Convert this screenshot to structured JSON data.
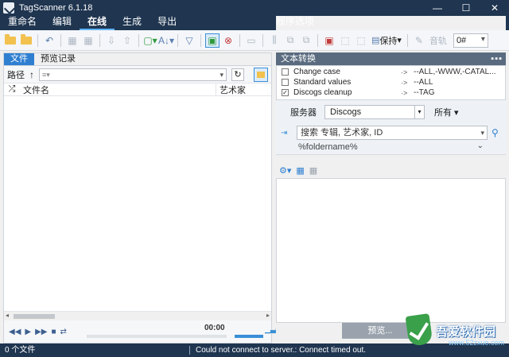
{
  "window": {
    "title": "TagScanner 6.1.18",
    "min": "—",
    "max": "☐",
    "close": "✕"
  },
  "menu": {
    "items": [
      {
        "label": "重命名",
        "active": false
      },
      {
        "label": "编辑",
        "active": false
      },
      {
        "label": "在线",
        "active": true
      },
      {
        "label": "生成",
        "active": false
      },
      {
        "label": "导出",
        "active": false
      }
    ],
    "options": "程序选项"
  },
  "toolbar": {
    "keep_label": "保持",
    "track_label": "音轨",
    "track_value": "0#"
  },
  "left": {
    "tabs": [
      "文件",
      "预览记录"
    ],
    "path_label": "路径",
    "path_value": "≡▾",
    "columns": [
      "文件名",
      "艺术家"
    ],
    "time": "00:00"
  },
  "right": {
    "header": "文本转换",
    "transforms": [
      {
        "checked": false,
        "name": "Change case",
        "dest": "--ALL,-WWW,-CATAL..."
      },
      {
        "checked": false,
        "name": "Standard values",
        "dest": "--ALL"
      },
      {
        "checked": true,
        "name": "Discogs cleanup",
        "dest": "--TAG"
      }
    ],
    "server_label": "服务器",
    "server_value": "Discogs",
    "all_label": "所有 ▾",
    "search_placeholder": "搜索 专辑, 艺术家, ID",
    "folder_pattern": "%foldername%",
    "preview_button": "预览..."
  },
  "status": {
    "files": "0 个文件",
    "message": "Could not connect to server.: Connect timed out."
  },
  "watermark": {
    "name": "吾爱软件园",
    "url": "www.52zxue.com"
  }
}
